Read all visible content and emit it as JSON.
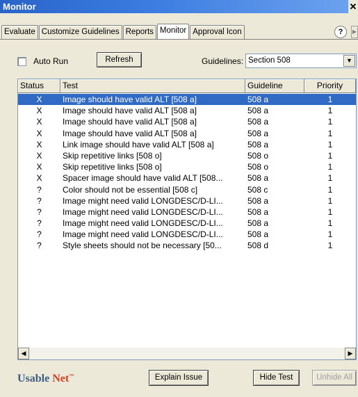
{
  "window": {
    "title": "Monitor",
    "close": "✕"
  },
  "tabs": [
    "Evaluate",
    "Customize Guidelines",
    "Reports",
    "Monitor",
    "Approval Icon"
  ],
  "help": "?",
  "toolbar": {
    "autorun_label": "Auto Run",
    "autorun_checked": false,
    "refresh_label": "Refresh",
    "guidelines_label": "Guidelines:",
    "guidelines_value": "Section 508"
  },
  "table": {
    "columns": [
      "Status",
      "Test",
      "Guideline",
      "Priority"
    ],
    "rows": [
      {
        "status": "X",
        "test": "Image should have valid ALT [508 a]",
        "guideline": "508 a",
        "priority": "1",
        "selected": true
      },
      {
        "status": "X",
        "test": "Image should have valid ALT [508 a]",
        "guideline": "508 a",
        "priority": "1"
      },
      {
        "status": "X",
        "test": "Image should have valid ALT [508 a]",
        "guideline": "508 a",
        "priority": "1"
      },
      {
        "status": "X",
        "test": "Image should have valid ALT [508 a]",
        "guideline": "508 a",
        "priority": "1"
      },
      {
        "status": "X",
        "test": "Link image should have valid ALT [508 a]",
        "guideline": "508 a",
        "priority": "1"
      },
      {
        "status": "X",
        "test": "Skip repetitive links [508 o]",
        "guideline": "508 o",
        "priority": "1"
      },
      {
        "status": "X",
        "test": "Skip repetitive links [508 o]",
        "guideline": "508 o",
        "priority": "1"
      },
      {
        "status": "X",
        "test": "Spacer image should have valid ALT [508...",
        "guideline": "508 a",
        "priority": "1"
      },
      {
        "status": "?",
        "test": "Color should not be essential [508 c]",
        "guideline": "508 c",
        "priority": "1"
      },
      {
        "status": "?",
        "test": "Image might need valid LONGDESC/D-LI...",
        "guideline": "508 a",
        "priority": "1"
      },
      {
        "status": "?",
        "test": "Image might need valid LONGDESC/D-LI...",
        "guideline": "508 a",
        "priority": "1"
      },
      {
        "status": "?",
        "test": "Image might need valid LONGDESC/D-LI...",
        "guideline": "508 a",
        "priority": "1"
      },
      {
        "status": "?",
        "test": "Image might need valid LONGDESC/D-LI...",
        "guideline": "508 a",
        "priority": "1"
      },
      {
        "status": "?",
        "test": "Style sheets should not be necessary [50...",
        "guideline": "508 d",
        "priority": "1"
      }
    ]
  },
  "footer": {
    "logo_part1": "Usable",
    "logo_part2": "Net",
    "logo_tm": "™",
    "explain_label": "Explain Issue",
    "hide_label": "Hide Test",
    "unhide_label": "Unhide All"
  },
  "colors": {
    "selection": "#316ac5",
    "titlebar": "#2a64c8",
    "logo_blue": "#3d5d82",
    "logo_red": "#d84024"
  }
}
